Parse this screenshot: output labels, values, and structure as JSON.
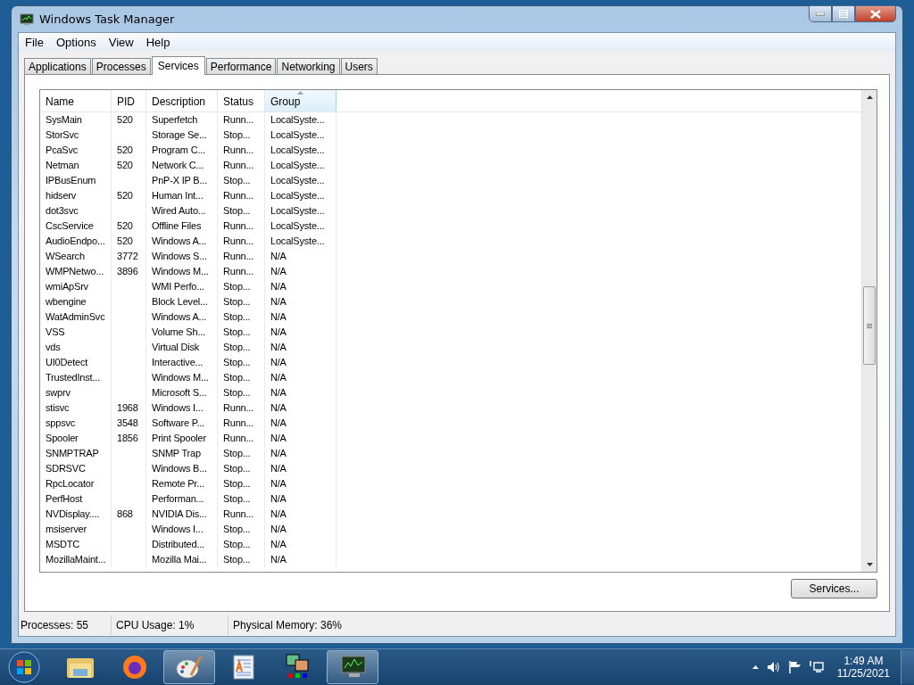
{
  "window": {
    "title": "Windows Task Manager"
  },
  "menu": [
    {
      "label": "File"
    },
    {
      "label": "Options"
    },
    {
      "label": "View"
    },
    {
      "label": "Help"
    }
  ],
  "tabs": [
    {
      "label": "Applications",
      "selected": false
    },
    {
      "label": "Processes",
      "selected": false
    },
    {
      "label": "Services",
      "selected": true
    },
    {
      "label": "Performance",
      "selected": false
    },
    {
      "label": "Networking",
      "selected": false
    },
    {
      "label": "Users",
      "selected": false
    }
  ],
  "table": {
    "columns": [
      {
        "label": "Name",
        "sorted": false
      },
      {
        "label": "PID",
        "sorted": false
      },
      {
        "label": "Description",
        "sorted": false
      },
      {
        "label": "Status",
        "sorted": false
      },
      {
        "label": "Group",
        "sorted": true
      }
    ],
    "rows": [
      [
        "SysMain",
        "520",
        "Superfetch",
        "Runn...",
        "LocalSyste..."
      ],
      [
        "StorSvc",
        "",
        "Storage Se...",
        "Stop...",
        "LocalSyste..."
      ],
      [
        "PcaSvc",
        "520",
        "Program C...",
        "Runn...",
        "LocalSyste..."
      ],
      [
        "Netman",
        "520",
        "Network C...",
        "Runn...",
        "LocalSyste..."
      ],
      [
        "IPBusEnum",
        "",
        "PnP-X IP B...",
        "Stop...",
        "LocalSyste..."
      ],
      [
        "hidserv",
        "520",
        "Human Int...",
        "Runn...",
        "LocalSyste..."
      ],
      [
        "dot3svc",
        "",
        "Wired Auto...",
        "Stop...",
        "LocalSyste..."
      ],
      [
        "CscService",
        "520",
        "Offline Files",
        "Runn...",
        "LocalSyste..."
      ],
      [
        "AudioEndpo...",
        "520",
        "Windows A...",
        "Runn...",
        "LocalSyste..."
      ],
      [
        "WSearch",
        "3772",
        "Windows S...",
        "Runn...",
        "N/A"
      ],
      [
        "WMPNetwo...",
        "3896",
        "Windows M...",
        "Runn...",
        "N/A"
      ],
      [
        "wmiApSrv",
        "",
        "WMI Perfo...",
        "Stop...",
        "N/A"
      ],
      [
        "wbengine",
        "",
        "Block Level...",
        "Stop...",
        "N/A"
      ],
      [
        "WatAdminSvc",
        "",
        "Windows A...",
        "Stop...",
        "N/A"
      ],
      [
        "VSS",
        "",
        "Volume Sh...",
        "Stop...",
        "N/A"
      ],
      [
        "vds",
        "",
        "Virtual Disk",
        "Stop...",
        "N/A"
      ],
      [
        "UI0Detect",
        "",
        "Interactive...",
        "Stop...",
        "N/A"
      ],
      [
        "TrustedInst...",
        "",
        "Windows M...",
        "Stop...",
        "N/A"
      ],
      [
        "swprv",
        "",
        "Microsoft S...",
        "Stop...",
        "N/A"
      ],
      [
        "stisvc",
        "1968",
        "Windows I...",
        "Runn...",
        "N/A"
      ],
      [
        "sppsvc",
        "3548",
        "Software P...",
        "Runn...",
        "N/A"
      ],
      [
        "Spooler",
        "1856",
        "Print Spooler",
        "Runn...",
        "N/A"
      ],
      [
        "SNMPTRAP",
        "",
        "SNMP Trap",
        "Stop...",
        "N/A"
      ],
      [
        "SDRSVC",
        "",
        "Windows B...",
        "Stop...",
        "N/A"
      ],
      [
        "RpcLocator",
        "",
        "Remote Pr...",
        "Stop...",
        "N/A"
      ],
      [
        "PerfHost",
        "",
        "Performan...",
        "Stop...",
        "N/A"
      ],
      [
        "NVDisplay....",
        "868",
        "NVIDIA Dis...",
        "Runn...",
        "N/A"
      ],
      [
        "msiserver",
        "",
        "Windows I...",
        "Stop...",
        "N/A"
      ],
      [
        "MSDTC",
        "",
        "Distributed...",
        "Stop...",
        "N/A"
      ],
      [
        "MozillaMaint...",
        "",
        "Mozilla Mai...",
        "Stop...",
        "N/A"
      ]
    ]
  },
  "services_button": "Services...",
  "status_bar": [
    "Processes: 55",
    "CPU Usage: 1%",
    "Physical Memory: 36%"
  ],
  "taskbar": {
    "items": [
      {
        "kind": "folder",
        "active": false
      },
      {
        "kind": "firefox",
        "active": false
      },
      {
        "kind": "paint",
        "active": true
      },
      {
        "kind": "wordpad",
        "active": false
      },
      {
        "kind": "imageapp",
        "active": false
      },
      {
        "kind": "taskmgr",
        "active": true
      }
    ],
    "time": "1:49 AM",
    "date": "11/25/2021"
  }
}
